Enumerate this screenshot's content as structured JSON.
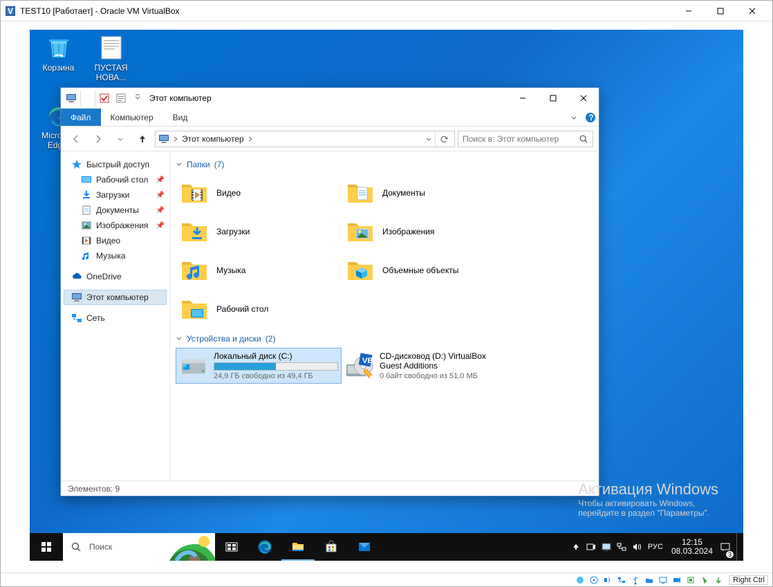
{
  "host_window": {
    "title": "TEST10 [Работает] - Oracle VM VirtualBox",
    "host_key": "Right Ctrl"
  },
  "desktop_icons": [
    {
      "id": "recycle-bin",
      "label": "Корзина"
    },
    {
      "id": "notepad-doc",
      "label": "ПУСТАЯ НОВА..."
    },
    {
      "id": "edge",
      "label": "Microsoft Edg..."
    }
  ],
  "explorer": {
    "title": "Этот компьютер",
    "ribbon": {
      "file": "Файл",
      "computer": "Компьютер",
      "view": "Вид"
    },
    "address": {
      "location": "Этот компьютер"
    },
    "search_placeholder": "Поиск в: Этот компьютер",
    "nav": {
      "quick": "Быстрый доступ",
      "quick_items": [
        {
          "id": "desktop",
          "label": "Рабочий стол",
          "pinned": true
        },
        {
          "id": "downloads",
          "label": "Загрузки",
          "pinned": true
        },
        {
          "id": "documents",
          "label": "Документы",
          "pinned": true
        },
        {
          "id": "pictures",
          "label": "Изображения",
          "pinned": true
        },
        {
          "id": "videos",
          "label": "Видео",
          "pinned": false
        },
        {
          "id": "music",
          "label": "Музыка",
          "pinned": false
        }
      ],
      "onedrive": "OneDrive",
      "this_pc": "Этот компьютер",
      "network": "Сеть"
    },
    "groups": {
      "folders": {
        "label": "Папки",
        "count": "(7)",
        "items": [
          {
            "id": "videos",
            "label": "Видео"
          },
          {
            "id": "documents",
            "label": "Документы"
          },
          {
            "id": "downloads",
            "label": "Загрузки"
          },
          {
            "id": "pictures",
            "label": "Изображения"
          },
          {
            "id": "music",
            "label": "Музыка"
          },
          {
            "id": "3dobjects",
            "label": "Объемные объекты"
          },
          {
            "id": "desktop",
            "label": "Рабочий стол"
          }
        ]
      },
      "drives": {
        "label": "Устройства и диски",
        "count": "(2)",
        "items": [
          {
            "id": "c",
            "name": "Локальный диск (C:)",
            "free": "24,9 ГБ свободно из 49,4 ГБ",
            "fill_pct": 50,
            "selected": true,
            "kind": "hdd"
          },
          {
            "id": "d",
            "name": "CD-дисковод (D:) VirtualBox Guest Additions",
            "free": "0 байт свободно из 51,0 МБ",
            "fill_pct": 0,
            "selected": false,
            "kind": "cd"
          }
        ]
      }
    },
    "status": "Элементов: 9"
  },
  "watermark": {
    "heading": "Активация Windows",
    "line1": "Чтобы активировать Windows,",
    "line2": "перейдите в раздел \"Параметры\"."
  },
  "taskbar": {
    "search_placeholder": "Поиск",
    "lang": "РУС",
    "time": "12:15",
    "date": "08.03.2024",
    "notif_count": "3"
  }
}
